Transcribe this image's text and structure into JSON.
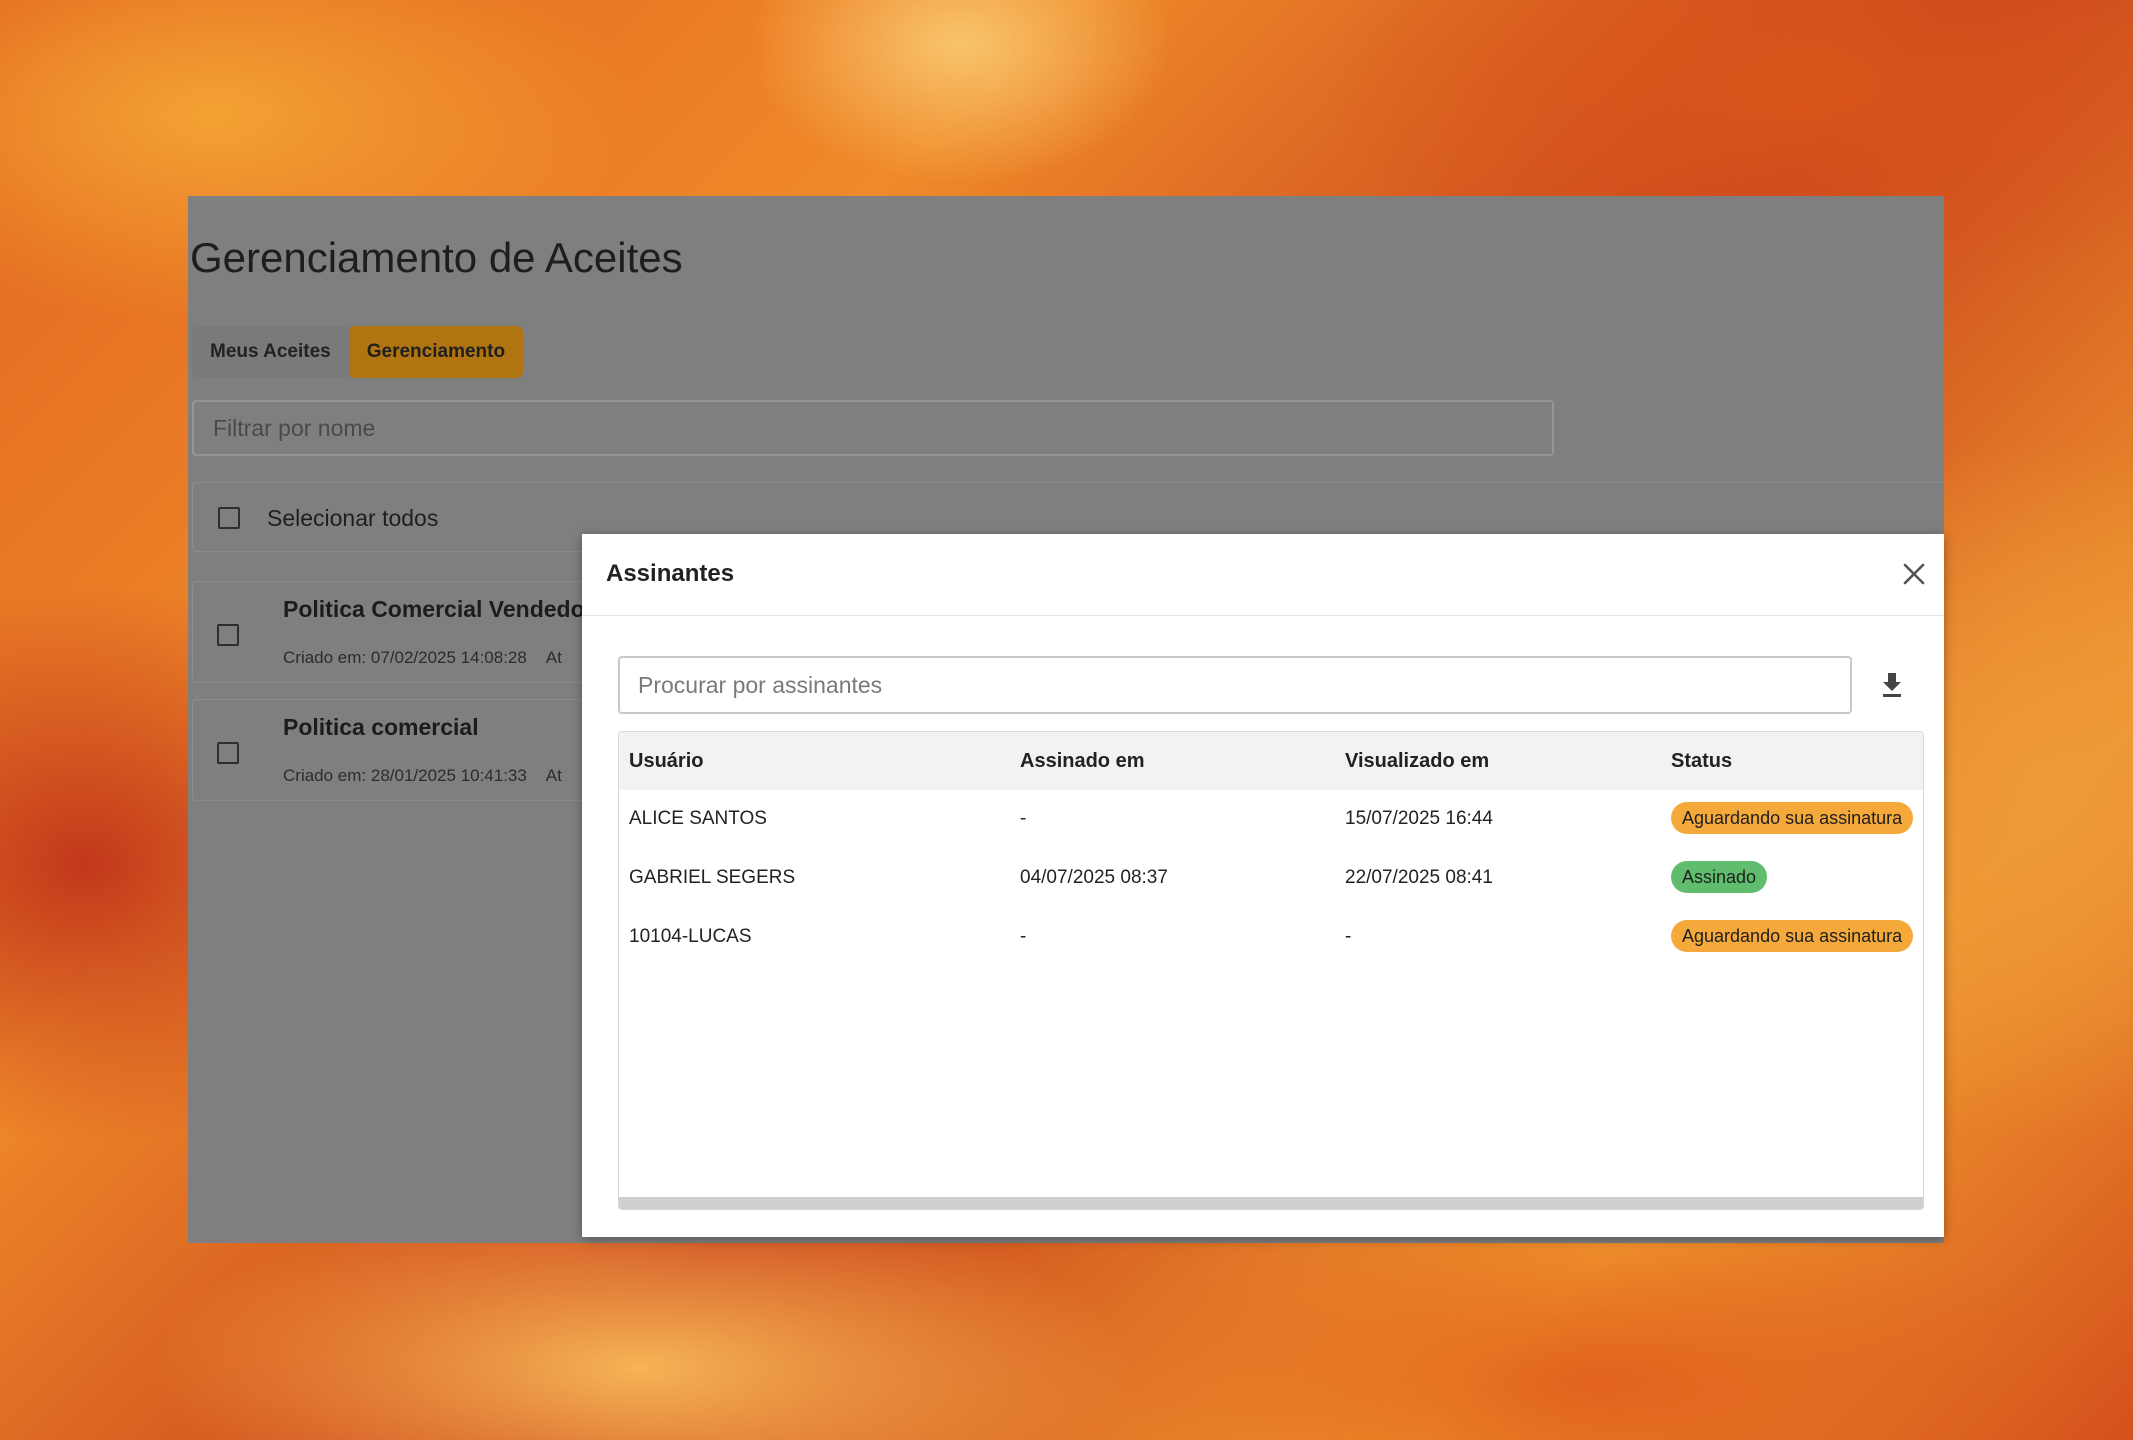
{
  "page": {
    "title": "Gerenciamento de Aceites",
    "tabs": [
      {
        "label": "Meus Aceites",
        "active": false
      },
      {
        "label": "Gerenciamento",
        "active": true
      }
    ],
    "filter_placeholder": "Filtrar por nome",
    "select_all_label": "Selecionar todos",
    "documents": [
      {
        "title": "Politica Comercial Vendedore",
        "created": "Criado em: 07/02/2025 14:08:28",
        "extra": "At"
      },
      {
        "title": "Politica comercial",
        "created": "Criado em: 28/01/2025 10:41:33",
        "extra": "At"
      }
    ]
  },
  "modal": {
    "title": "Assinantes",
    "search_placeholder": "Procurar por assinantes",
    "columns": {
      "user": "Usuário",
      "signed_at": "Assinado em",
      "viewed_at": "Visualizado em",
      "status": "Status"
    },
    "rows": [
      {
        "user": "ALICE SANTOS",
        "signed_at": "-",
        "viewed_at": "15/07/2025 16:44",
        "status": "Aguardando sua assinatura",
        "status_type": "pending"
      },
      {
        "user": "GABRIEL SEGERS",
        "signed_at": "04/07/2025 08:37",
        "viewed_at": "22/07/2025 08:41",
        "status": "Assinado",
        "status_type": "signed"
      },
      {
        "user": "10104-LUCAS",
        "signed_at": "-",
        "viewed_at": "-",
        "status": "Aguardando sua assinatura",
        "status_type": "pending"
      }
    ]
  },
  "colors": {
    "accent": "#b07510",
    "pending": "#f5a93b",
    "signed": "#5fbd6d"
  }
}
